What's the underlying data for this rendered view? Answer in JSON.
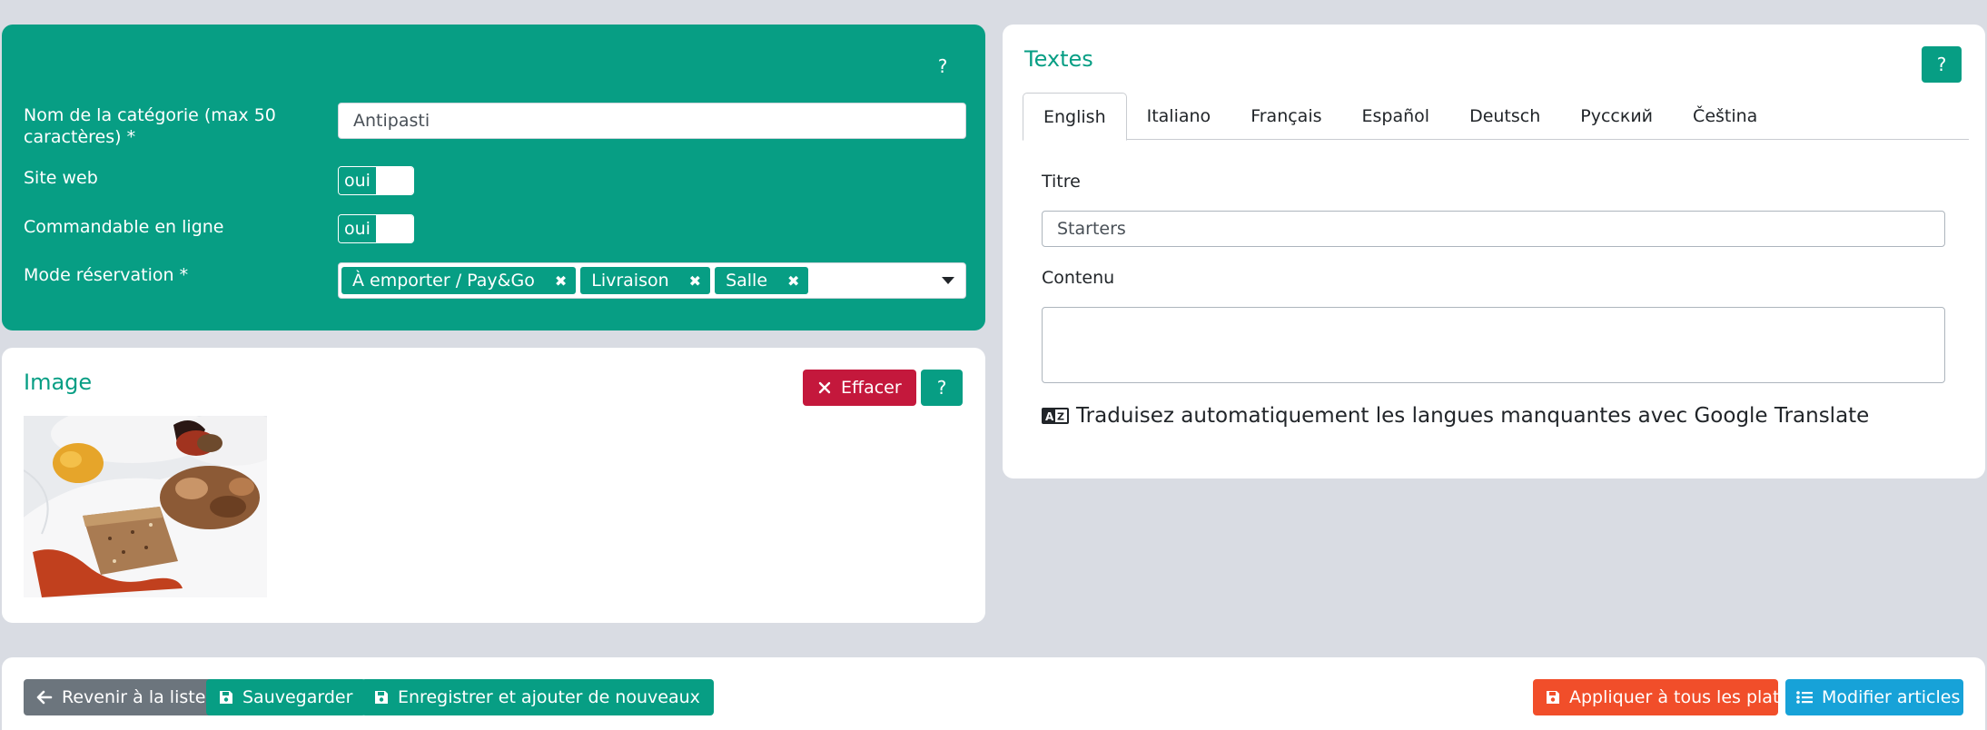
{
  "main_form": {
    "help_label": "?",
    "category_name": {
      "label_line1": "Nom de la catégorie (max 50",
      "label_line2": "caractères)  *",
      "value": "Antipasti"
    },
    "website": {
      "label": "Site web",
      "toggle_label": "oui"
    },
    "online_order": {
      "label": "Commandable en ligne",
      "toggle_label": "oui"
    },
    "booking_mode": {
      "label": "Mode réservation  *",
      "tags": [
        "À emporter / Pay&Go",
        "Livraison",
        "Salle"
      ],
      "remove_glyph": "✖"
    }
  },
  "image_panel": {
    "title": "Image",
    "clear_button": "Effacer",
    "help_label": "?",
    "photo_icon": "food-photo"
  },
  "texts_panel": {
    "title": "Textes",
    "help_label": "?",
    "tabs": [
      "English",
      "Italiano",
      "Français",
      "Español",
      "Deutsch",
      "Русский",
      "Čeština"
    ],
    "active_tab": "English",
    "title_field": {
      "label": "Titre",
      "value": "Starters"
    },
    "content_field": {
      "label": "Contenu",
      "value": ""
    },
    "translate_text": "Traduisez automatiquement les langues manquantes avec Google Translate",
    "translate_icon": "language-icon"
  },
  "footer": {
    "back_button": "Revenir à la liste",
    "save_button": "Sauvegarder",
    "save_add_button": "Enregistrer et ajouter de nouveaux",
    "apply_all_button": "Appliquer à tous les plats",
    "edit_items_button": "Modifier articles"
  },
  "colors": {
    "primary": "#079e84",
    "danger": "#c4183c",
    "secondary": "#6c757d",
    "orange": "#f14e2a",
    "info": "#17a2d8",
    "background": "#d9dce3"
  }
}
